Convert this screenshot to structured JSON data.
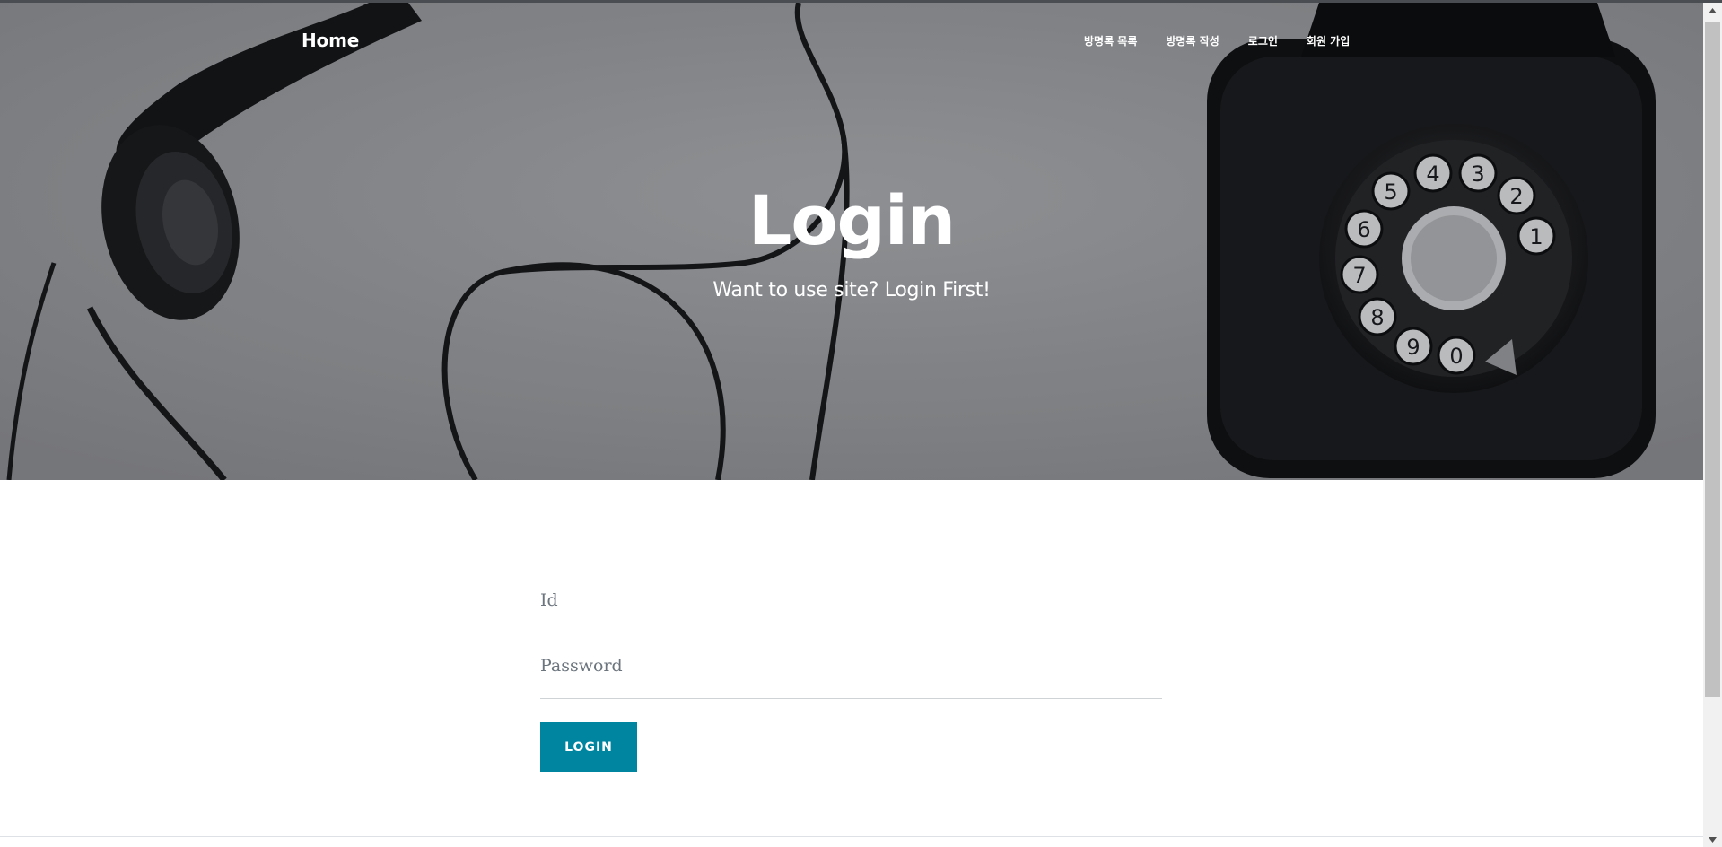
{
  "navbar": {
    "brand": "Home",
    "items": [
      {
        "label": "방명록 목록"
      },
      {
        "label": "방명록 작성"
      },
      {
        "label": "로그인"
      },
      {
        "label": "회원 가입"
      }
    ]
  },
  "hero": {
    "heading": "Login",
    "subheading": "Want to use site? Login First!",
    "background_subject": "rotary telephone"
  },
  "form": {
    "id_placeholder": "Id",
    "password_placeholder": "Password",
    "submit_label": "LOGIN"
  },
  "colors": {
    "accent": "#0085a1",
    "hero_overlay": "#8a8c90",
    "divider": "#dee2e6"
  }
}
